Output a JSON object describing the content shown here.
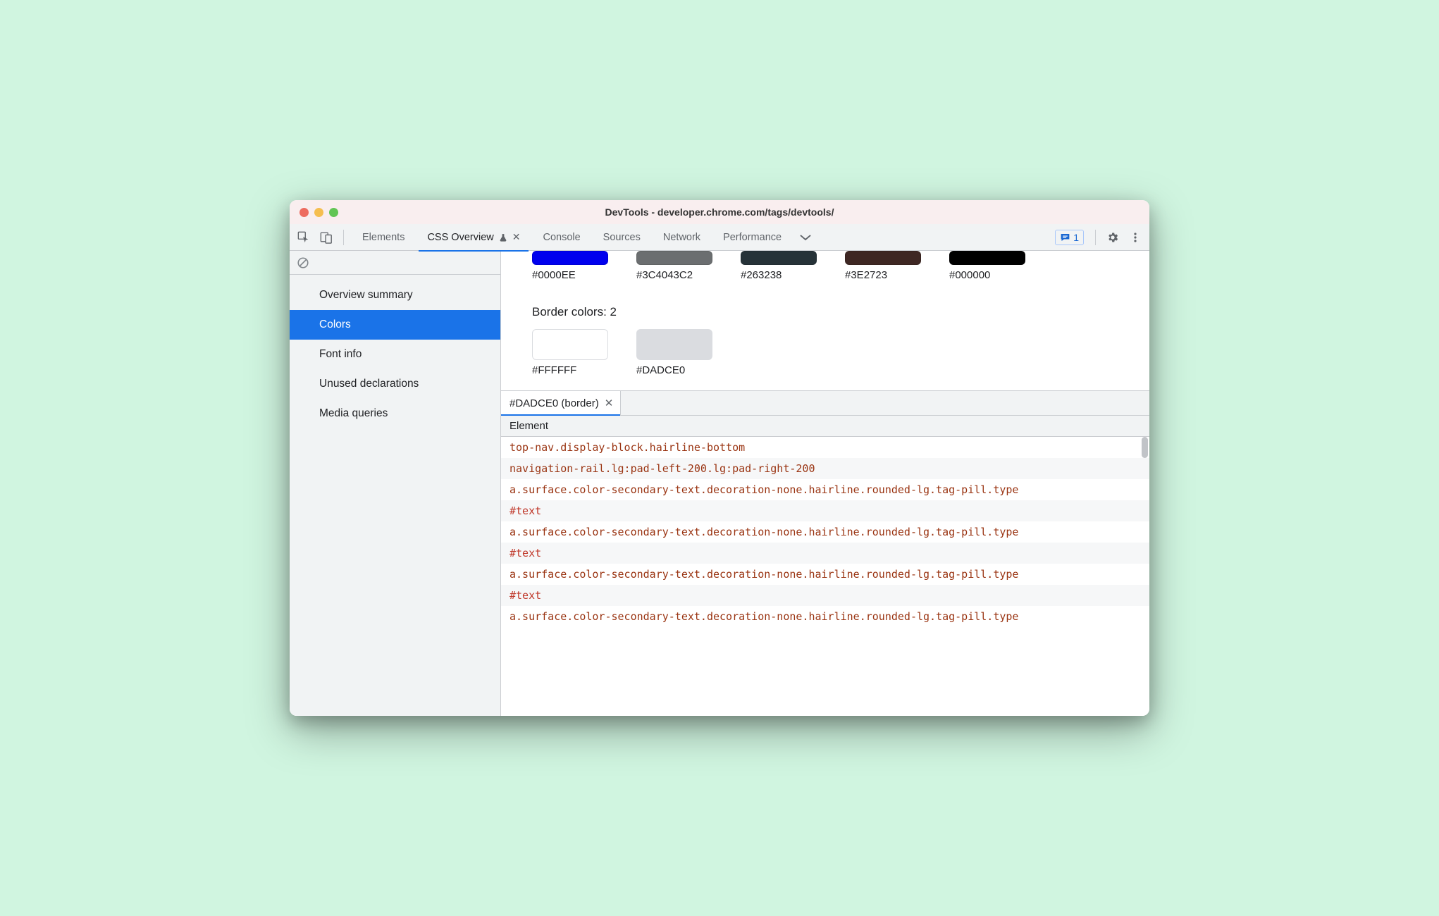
{
  "window": {
    "title": "DevTools - developer.chrome.com/tags/devtools/"
  },
  "tabs": [
    {
      "label": "Elements",
      "active": false
    },
    {
      "label": "CSS Overview",
      "active": true,
      "experimental": true,
      "closable": true
    },
    {
      "label": "Console",
      "active": false
    },
    {
      "label": "Sources",
      "active": false
    },
    {
      "label": "Network",
      "active": false
    },
    {
      "label": "Performance",
      "active": false
    }
  ],
  "messages_count": "1",
  "sidebar": {
    "items": [
      {
        "label": "Overview summary"
      },
      {
        "label": "Colors"
      },
      {
        "label": "Font info"
      },
      {
        "label": "Unused declarations"
      },
      {
        "label": "Media queries"
      }
    ],
    "active_index": 1
  },
  "top_swatches": [
    {
      "hex": "#0000EE"
    },
    {
      "hex": "#3C4043C2"
    },
    {
      "hex": "#263238"
    },
    {
      "hex": "#3E2723"
    },
    {
      "hex": "#000000"
    }
  ],
  "border_section": {
    "title": "Border colors: 2",
    "swatches": [
      {
        "hex": "#FFFFFF"
      },
      {
        "hex": "#DADCE0"
      }
    ]
  },
  "details": {
    "tab_label": "#DADCE0 (border)",
    "header": "Element",
    "rows": [
      {
        "text": "top-nav.display-block.hairline-bottom",
        "type": "el"
      },
      {
        "text": "navigation-rail.lg:pad-left-200.lg:pad-right-200",
        "type": "el"
      },
      {
        "text": "a.surface.color-secondary-text.decoration-none.hairline.rounded-lg.tag-pill.type",
        "type": "el"
      },
      {
        "text": "#text",
        "type": "text"
      },
      {
        "text": "a.surface.color-secondary-text.decoration-none.hairline.rounded-lg.tag-pill.type",
        "type": "el"
      },
      {
        "text": "#text",
        "type": "text"
      },
      {
        "text": "a.surface.color-secondary-text.decoration-none.hairline.rounded-lg.tag-pill.type",
        "type": "el"
      },
      {
        "text": "#text",
        "type": "text"
      },
      {
        "text": "a.surface.color-secondary-text.decoration-none.hairline.rounded-lg.tag-pill.type",
        "type": "el"
      }
    ]
  }
}
